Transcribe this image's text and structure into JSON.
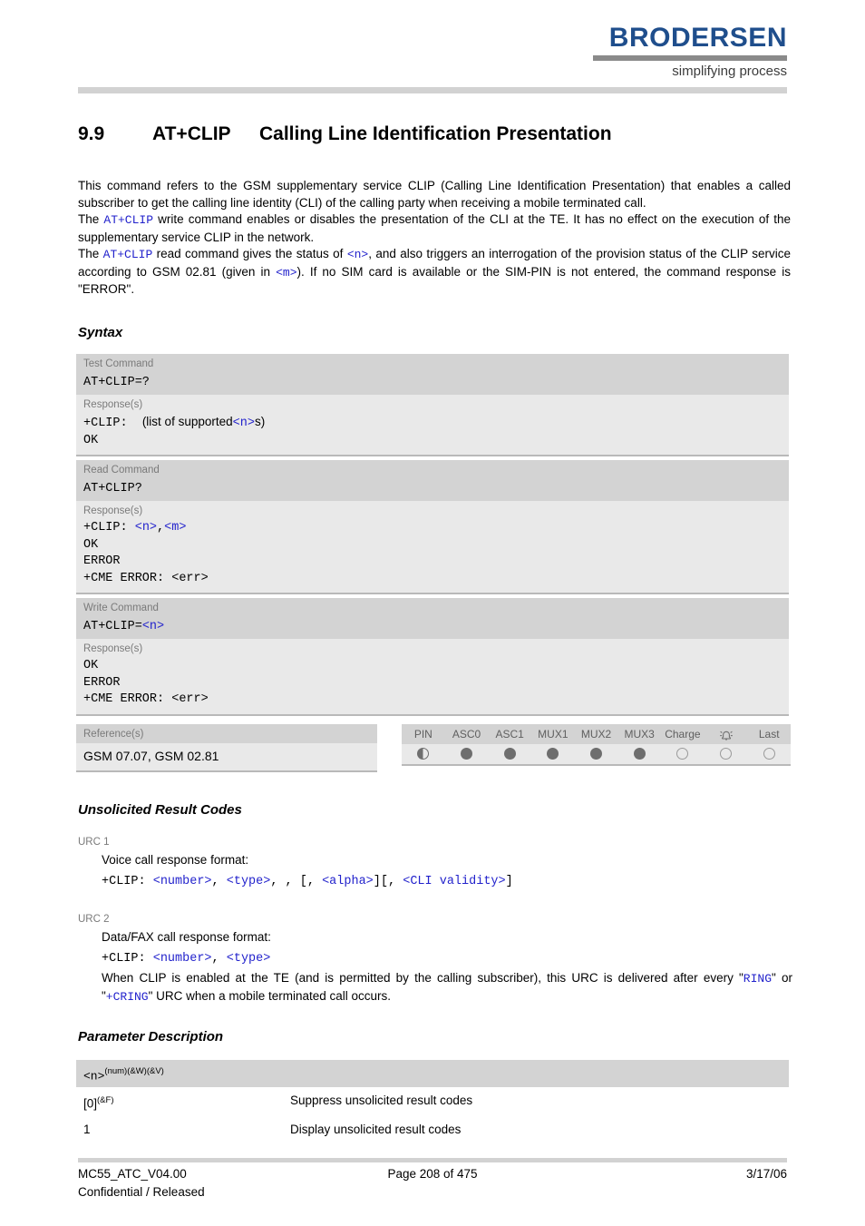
{
  "header": {
    "logo_word": "BRODERSEN",
    "logo_tagline": "simplifying process",
    "brand_color": "#1f4e8c"
  },
  "title": {
    "number": "9.9",
    "command": "AT+CLIP",
    "text": "Calling Line Identification Presentation"
  },
  "intro": {
    "p1_a": "This command refers to the GSM supplementary service CLIP (Calling Line Identification Presentation) that enables a called subscriber to get the calling line identity (CLI) of the calling party when receiving a mobile terminated call.",
    "p2_a": "The ",
    "p2_code": "AT+CLIP",
    "p2_b": " write command enables or disables the presentation of the CLI at the TE. It has no effect on the execution of the supplementary service CLIP in the network.",
    "p3_a": "The ",
    "p3_code": "AT+CLIP",
    "p3_b": " read command gives the status of ",
    "p3_n": "<n>",
    "p3_c": ", and also triggers an interrogation of the provision status of the CLIP service according to GSM 02.81 (given in ",
    "p3_m": "<m>",
    "p3_d": "). If no SIM card is available or the SIM-PIN is not entered, the command response is \"ERROR\"."
  },
  "sections": {
    "syntax": "Syntax",
    "urc": "Unsolicited Result Codes",
    "parameter": "Parameter Description"
  },
  "syntax": {
    "test": {
      "label": "Test Command",
      "command": "AT+CLIP=?",
      "response_label": "Response(s)",
      "resp_prefix": "+CLIP:",
      "resp_text": "(list of supported",
      "resp_param": "<n>",
      "resp_suffix": "s)",
      "resp_ok": "OK"
    },
    "read": {
      "label": "Read Command",
      "command": "AT+CLIP?",
      "response_label": "Response(s)",
      "resp_prefix": "+CLIP:",
      "resp_n": "<n>",
      "resp_comma": ",",
      "resp_m": "<m>",
      "lines": [
        "OK",
        "ERROR",
        "+CME ERROR: <err>"
      ]
    },
    "write": {
      "label": "Write Command",
      "command_prefix": "AT+CLIP=",
      "command_param": "<n>",
      "response_label": "Response(s)",
      "lines": [
        "OK",
        "ERROR",
        "+CME ERROR: <err>"
      ]
    }
  },
  "reference": {
    "label": "Reference(s)",
    "value": "GSM 07.07, GSM 02.81"
  },
  "pin_table": {
    "columns": [
      "PIN",
      "ASC0",
      "ASC1",
      "MUX1",
      "MUX2",
      "MUX3",
      "Charge",
      "alarm-icon",
      "Last"
    ],
    "states": [
      "half",
      "full",
      "full",
      "full",
      "full",
      "full",
      "empty",
      "empty",
      "empty"
    ]
  },
  "urc": [
    {
      "label": "URC 1",
      "title": "Voice call response format:",
      "code_prefix": "+CLIP:",
      "code_p1": "<number>",
      "code_sep1": ",",
      "code_p2": "<type>",
      "code_mid": ", , [,",
      "code_p3": "<alpha>",
      "code_mid2": "][,",
      "code_p4": "<CLI validity>",
      "code_end": "]"
    },
    {
      "label": "URC 2",
      "title": "Data/FAX call response format:",
      "code_prefix": "+CLIP:",
      "code_p1": "<number>",
      "code_sep1": ",",
      "code_p2": "<type>",
      "note_a": "When CLIP is enabled at the TE (and is permitted by the calling subscriber), this URC is delivered after every \"",
      "note_ring": "RING",
      "note_b": "\" or \"",
      "note_cring": "+CRING",
      "note_c": "\" URC when a mobile terminated call occurs."
    }
  ],
  "parameter": {
    "name": "<n>",
    "name_sup": "(num)(&W)(&V)",
    "rows": [
      {
        "value": "[0]",
        "value_sup": "(&F)",
        "description": "Suppress unsolicited result codes"
      },
      {
        "value": "1",
        "value_sup": "",
        "description": "Display unsolicited result codes"
      }
    ]
  },
  "footer": {
    "doc_id": "MC55_ATC_V04.00",
    "page": "Page 208 of 475",
    "date": "3/17/06",
    "classification": "Confidential / Released"
  }
}
